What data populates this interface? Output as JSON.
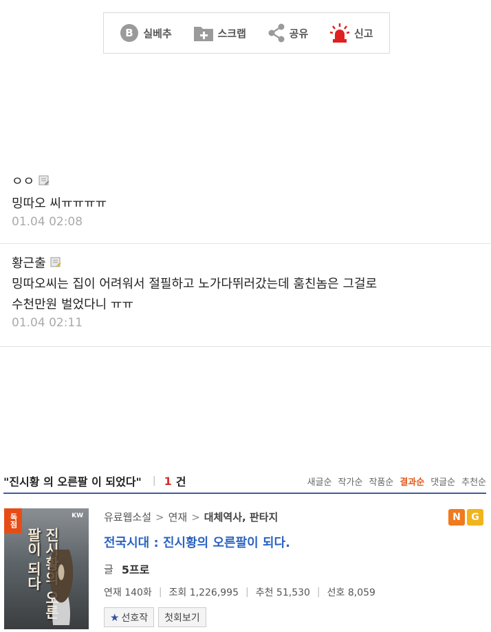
{
  "actions": [
    {
      "label": "실베추",
      "icon": "b-badge-icon"
    },
    {
      "label": "스크랩",
      "icon": "folder-plus-icon"
    },
    {
      "label": "공유",
      "icon": "share-icon"
    },
    {
      "label": "신고",
      "icon": "siren-icon"
    }
  ],
  "comments": [
    {
      "author": "ㅇㅇ",
      "text": "밍따오 씨ㅠㅠㅠㅠ",
      "time": "01.04 02:08"
    },
    {
      "author": "황근출",
      "text_lines": [
        "밍따오씨는 집이 어려워서 절필하고 노가다뛰러갔는데 훔친놈은 그걸로",
        "수천만원 벌었다니 ㅠㅠ"
      ],
      "time": "01.04 02:11"
    }
  ],
  "search": {
    "query": "\"진시황 의 오른팔 이 되었다\"",
    "separator": "|",
    "count": "1",
    "count_unit": "건",
    "sorts": [
      "새글순",
      "작가순",
      "작품순",
      "결과순",
      "댓글순",
      "추천순"
    ],
    "active_sort": "결과순",
    "colors": {
      "accent_line": "#3d5a9a",
      "active_sort": "#e05a1c",
      "count": "#d62e2e",
      "title_link": "#2a63c2"
    }
  },
  "result": {
    "cover": {
      "badge": "독점",
      "brand": "KW",
      "title": "진시황의 오른팔이 되다"
    },
    "breadcrumb": [
      "유료웹소설",
      "연재",
      "대체역사, 판타지"
    ],
    "flags": [
      "N",
      "G"
    ],
    "title": "전국시대 : 진시황의 오른팔이 되다.",
    "author_label": "글",
    "author": "5프로",
    "stats": [
      "연재 140화",
      "조회 1,226,995",
      "추천 51,530",
      "선호 8,059"
    ],
    "buttons": {
      "favorite": "선호작",
      "first": "첫회보기"
    }
  }
}
